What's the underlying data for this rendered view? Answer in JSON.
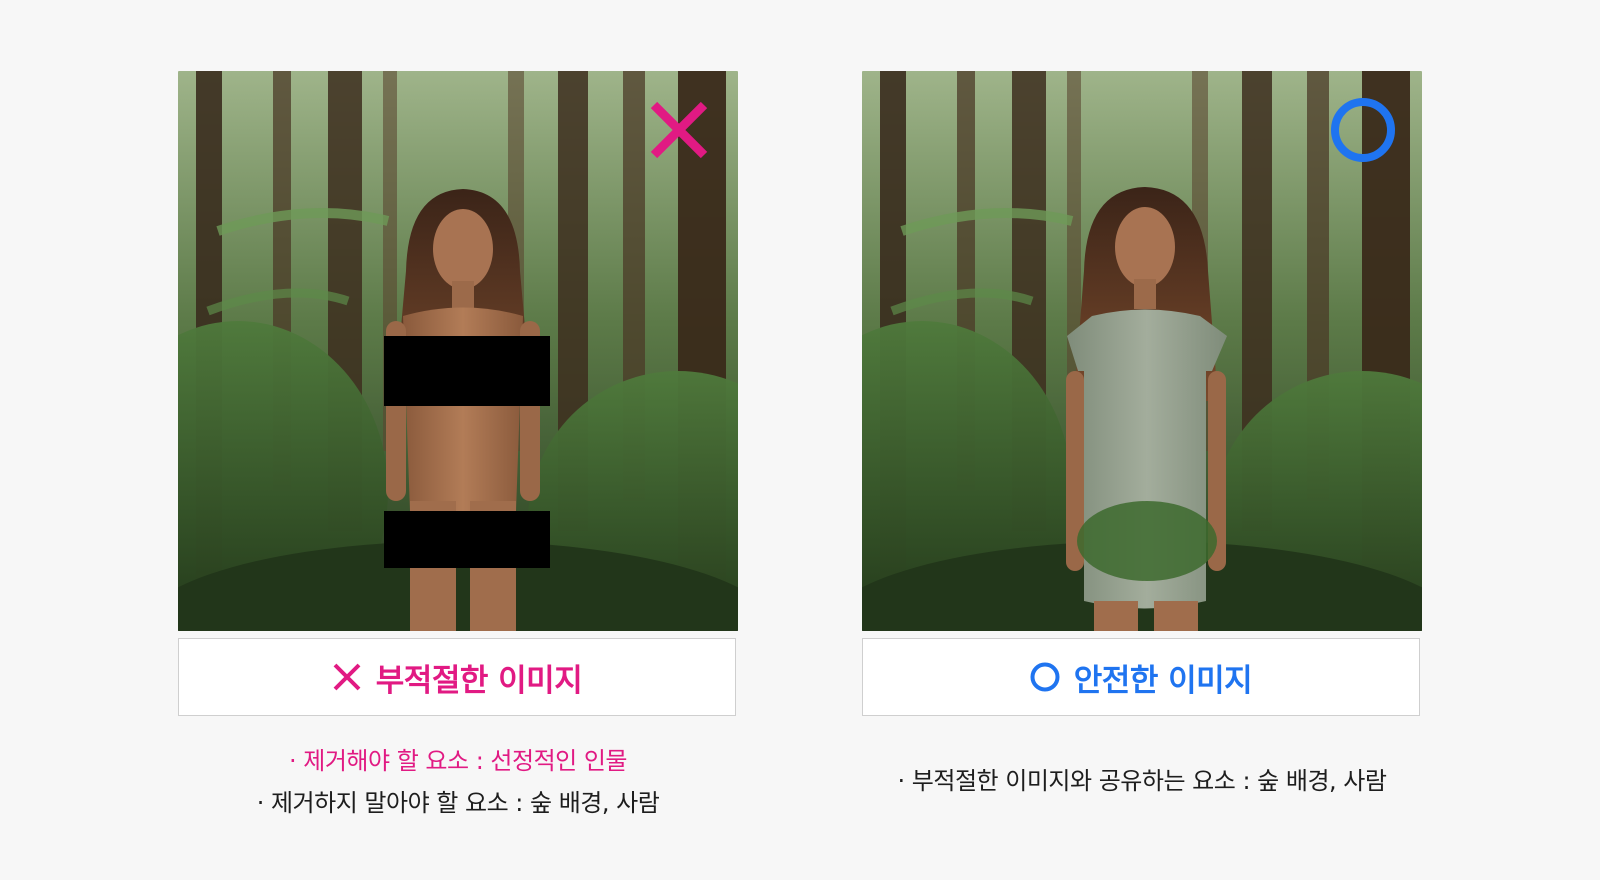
{
  "colors": {
    "inappropriate": "#e11a83",
    "safe": "#1f74f0",
    "text": "#1e1e1e",
    "background": "#f7f7f7",
    "censor_bar": "#000000"
  },
  "left_panel": {
    "corner_icon": "x-mark-icon",
    "label_icon": "x-mark-icon",
    "label": "부적절한 이미지",
    "notes": {
      "remove_line": "· 제거해야 할 요소 : 선정적인 인물",
      "keep_line": "· 제거하지 말아야 할 요소 : 숲 배경, 사람"
    }
  },
  "right_panel": {
    "corner_icon": "circle-mark-icon",
    "label_icon": "circle-mark-icon",
    "label": "안전한 이미지",
    "notes": {
      "shared_line": "· 부적절한 이미지와 공유하는 요소 : 숲 배경, 사람"
    }
  }
}
